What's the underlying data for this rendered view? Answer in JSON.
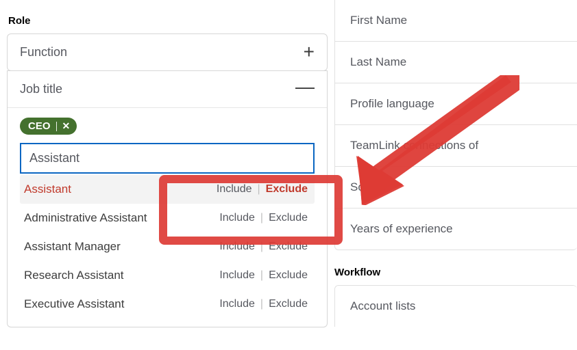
{
  "left": {
    "section_label": "Role",
    "function": {
      "label": "Function",
      "expanded": false
    },
    "job_title": {
      "label": "Job title",
      "expanded": true,
      "pill": {
        "text": "CEO"
      },
      "input_value": "Assistant",
      "suggestions": [
        {
          "text": "Assistant",
          "include": "Include",
          "exclude": "Exclude",
          "highlight": true
        },
        {
          "text": "Administrative Assistant",
          "include": "Include",
          "exclude": "Exclude",
          "highlight": false
        },
        {
          "text": "Assistant Manager",
          "include": "Include",
          "exclude": "Exclude",
          "highlight": false
        },
        {
          "text": "Research Assistant",
          "include": "Include",
          "exclude": "Exclude",
          "highlight": false
        },
        {
          "text": "Executive Assistant",
          "include": "Include",
          "exclude": "Exclude",
          "highlight": false
        }
      ]
    }
  },
  "right": {
    "filters": [
      "First Name",
      "Last Name",
      "Profile language",
      "TeamLink connections of",
      "School",
      "Years of experience"
    ],
    "workflow_label": "Workflow",
    "workflow": [
      "Account lists"
    ]
  }
}
